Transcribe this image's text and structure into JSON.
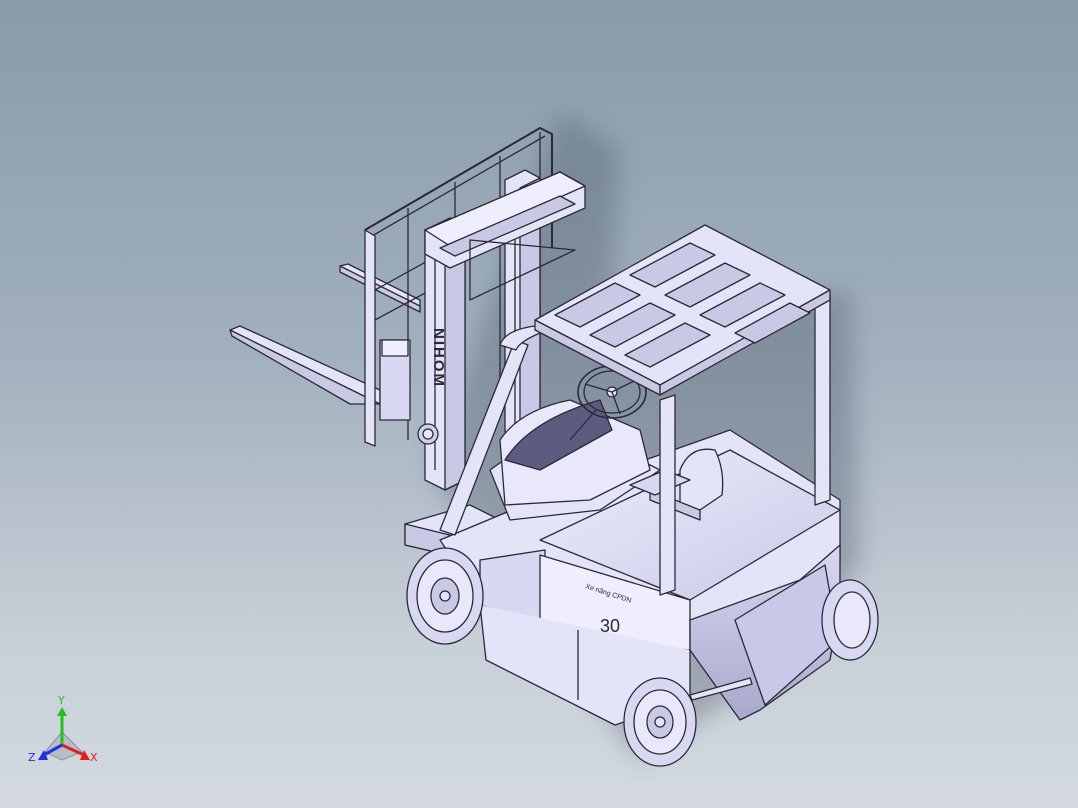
{
  "model": {
    "mast_brand_text": "NIHOM",
    "counterweight_capacity": "30",
    "side_label": "Xe nâng CPDN"
  },
  "triad": {
    "x_label": "X",
    "y_label": "Y",
    "z_label": "Z",
    "colors": {
      "x": "#e02020",
      "y": "#22c022",
      "z": "#2030e0"
    }
  },
  "colors": {
    "body_fill": "#e4e4f8",
    "body_shade": "#c9c9e6",
    "edge": "#2a2a36",
    "background_top": "#8a9aaa",
    "background_bottom": "#d3d9df"
  }
}
